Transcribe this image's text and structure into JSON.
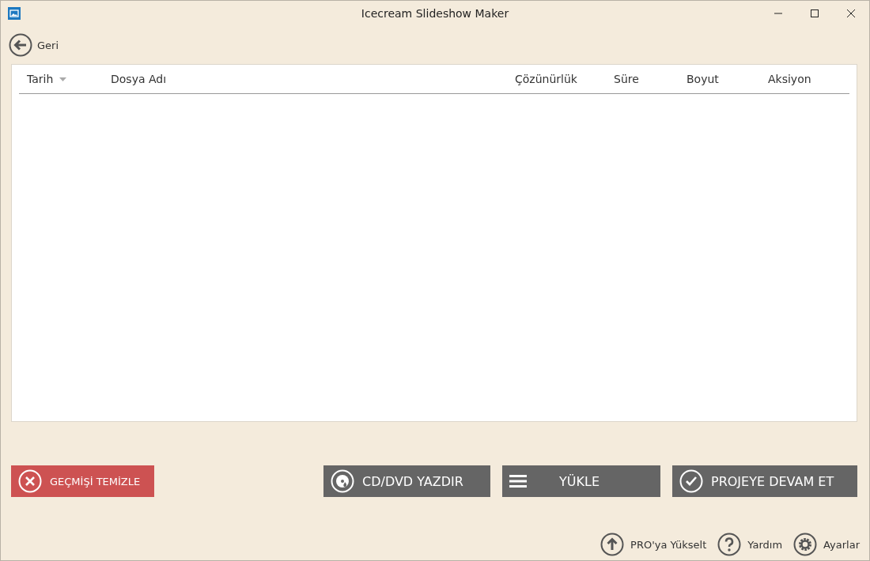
{
  "window": {
    "title": "Icecream Slideshow Maker"
  },
  "back": {
    "label": "Geri"
  },
  "table": {
    "columns": [
      {
        "label": "Tarih",
        "sorted": true
      },
      {
        "label": "Dosya Adı",
        "sorted": false
      },
      {
        "label": "Çözünürlük",
        "sorted": false
      },
      {
        "label": "Süre",
        "sorted": false
      },
      {
        "label": "Boyut",
        "sorted": false
      },
      {
        "label": "Aksiyon",
        "sorted": false
      }
    ]
  },
  "actions": [
    {
      "label": "GEÇMİŞİ TEMİZLE",
      "kind": "clear"
    },
    {
      "label": "CD/DVD YAZDIR",
      "kind": "disc"
    },
    {
      "label": "YÜKLE",
      "kind": "upload"
    },
    {
      "label": "PROJEYE DEVAM ET",
      "kind": "continue"
    }
  ],
  "footer": [
    {
      "label": "PRO'ya Yükselt",
      "kind": "upgrade"
    },
    {
      "label": "Yardım",
      "kind": "help"
    },
    {
      "label": "Ayarlar",
      "kind": "settings"
    }
  ]
}
